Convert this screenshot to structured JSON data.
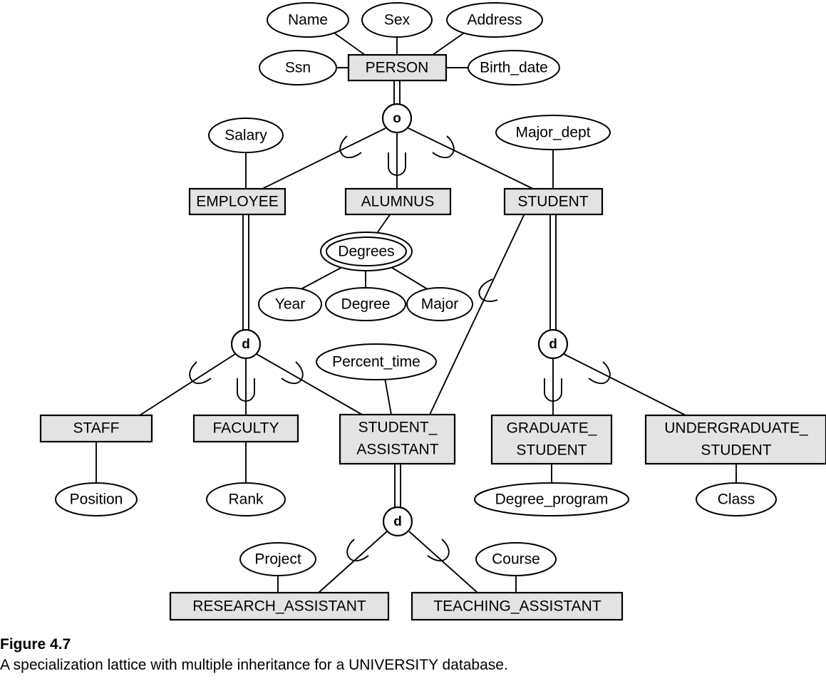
{
  "figure": {
    "number_label": "Figure 4.7",
    "caption": "A specialization lattice with multiple inheritance for a UNIVERSITY database."
  },
  "colors": {
    "entity_fill": "#e3e3e3",
    "attribute_fill": "#ffffff",
    "stroke": "#000000",
    "background": "#ffffff"
  },
  "entities": {
    "person": "PERSON",
    "employee": "EMPLOYEE",
    "alumnus": "ALUMNUS",
    "student": "STUDENT",
    "staff": "STAFF",
    "faculty": "FACULTY",
    "student_assistant": "STUDENT_",
    "student_assistant2": "ASSISTANT",
    "graduate_student": "GRADUATE_",
    "graduate_student2": "STUDENT",
    "undergraduate_student": "UNDERGRADUATE_",
    "undergraduate_student2": "STUDENT",
    "research_assistant": "RESEARCH_ASSISTANT",
    "teaching_assistant": "TEACHING_ASSISTANT"
  },
  "attributes": {
    "name": "Name",
    "sex": "Sex",
    "address": "Address",
    "ssn": "Ssn",
    "birth_date": "Birth_date",
    "salary": "Salary",
    "major_dept": "Major_dept",
    "degrees": "Degrees",
    "year": "Year",
    "degree": "Degree",
    "major": "Major",
    "percent_time": "Percent_time",
    "position": "Position",
    "rank": "Rank",
    "degree_program": "Degree_program",
    "class": "Class",
    "project": "Project",
    "course": "Course"
  },
  "specialization_circles": {
    "person_overlapping": "o",
    "employee_disjoint": "d",
    "student_disjoint": "d",
    "assistant_disjoint": "d"
  }
}
